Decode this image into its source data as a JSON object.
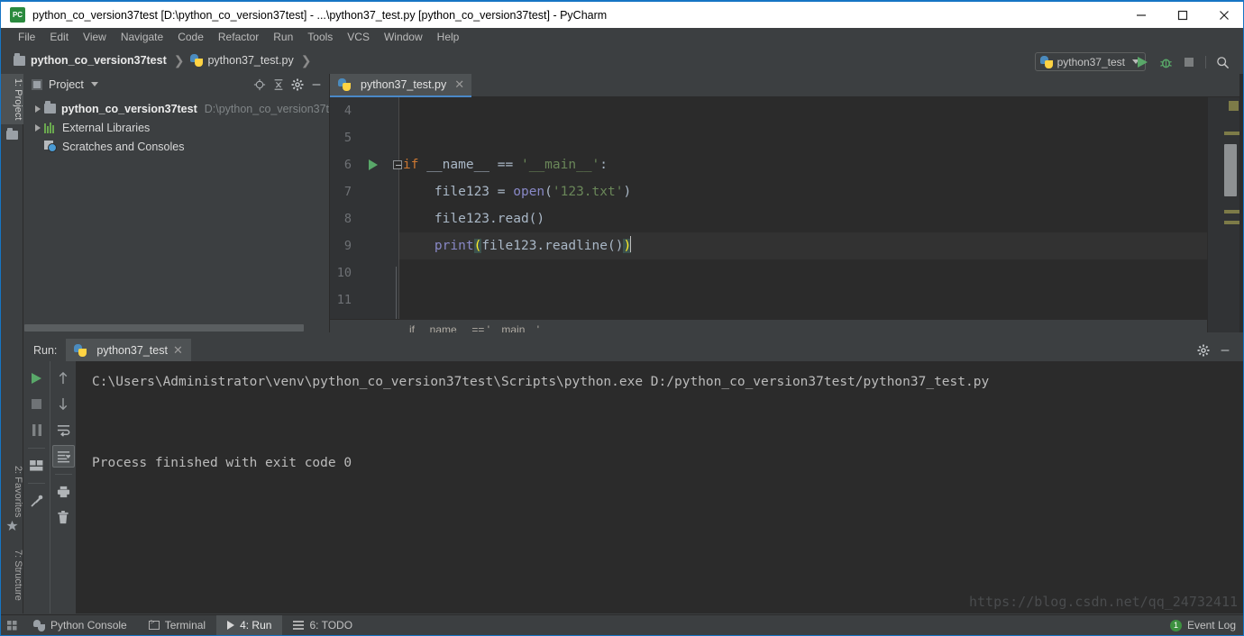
{
  "window": {
    "title": "python_co_version37test [D:\\python_co_version37test] - ...\\python37_test.py [python_co_version37test] - PyCharm",
    "app_icon": "pycharm-icon",
    "minimize_label": "—",
    "maximize_label": "□",
    "close_label": "✕"
  },
  "menu": {
    "items": [
      {
        "label": "File"
      },
      {
        "label": "Edit"
      },
      {
        "label": "View"
      },
      {
        "label": "Navigate"
      },
      {
        "label": "Code"
      },
      {
        "label": "Refactor"
      },
      {
        "label": "Run"
      },
      {
        "label": "Tools"
      },
      {
        "label": "VCS"
      },
      {
        "label": "Window"
      },
      {
        "label": "Help"
      }
    ]
  },
  "navbar": {
    "breadcrumb": [
      {
        "label": "python_co_version37test",
        "icon": "folder-icon"
      },
      {
        "label": "python37_test.py",
        "icon": "python-file-icon"
      }
    ],
    "separator": "❯",
    "run_config": {
      "label": "python37_test",
      "icon": "python-icon"
    },
    "actions": [
      {
        "name": "run-button",
        "icon": "play-icon"
      },
      {
        "name": "debug-button",
        "icon": "bug-icon"
      },
      {
        "name": "stop-button",
        "icon": "stop-icon"
      },
      {
        "name": "search-everywhere-button",
        "icon": "search-icon"
      }
    ]
  },
  "left_tool_tabs": [
    {
      "label": "1: Project",
      "icon": "folder-icon",
      "active": true
    },
    {
      "label": "2: Favorites",
      "icon": "star-icon",
      "active": false
    },
    {
      "label": "7: Structure",
      "icon": "structure-icon",
      "active": false
    }
  ],
  "project_panel": {
    "title": "Project",
    "icons": [
      {
        "name": "target-icon"
      },
      {
        "name": "collapse-all-icon"
      },
      {
        "name": "gear-icon"
      },
      {
        "name": "hide-icon"
      }
    ],
    "tree": [
      {
        "label": "python_co_version37test",
        "path": "D:\\python_co_version37t",
        "icon": "folder-icon",
        "expandable": true,
        "bold": true
      },
      {
        "label": "External Libraries",
        "path": "",
        "icon": "libraries-icon",
        "expandable": true,
        "bold": false
      },
      {
        "label": "Scratches and Consoles",
        "path": "",
        "icon": "scratches-icon",
        "expandable": false,
        "bold": false
      }
    ]
  },
  "editor": {
    "tab": {
      "label": "python37_test.py",
      "icon": "python-file-icon",
      "close": "✕"
    },
    "breadcrumb": "if __name__ == '__main__'",
    "lines": [
      {
        "no": "4",
        "gutter_run": false,
        "fold": false,
        "current": false,
        "tokens": []
      },
      {
        "no": "5",
        "gutter_run": false,
        "fold": false,
        "current": false,
        "tokens": []
      },
      {
        "no": "6",
        "gutter_run": true,
        "fold": true,
        "current": false,
        "tokens": [
          {
            "t": "if ",
            "c": "kw"
          },
          {
            "t": "__name__ ",
            "c": "id"
          },
          {
            "t": "== ",
            "c": "op"
          },
          {
            "t": "'__main__'",
            "c": "str"
          },
          {
            "t": ":",
            "c": "op"
          }
        ]
      },
      {
        "no": "7",
        "gutter_run": false,
        "fold": false,
        "current": false,
        "tokens": [
          {
            "t": "    file123 ",
            "c": "id"
          },
          {
            "t": "= ",
            "c": "op"
          },
          {
            "t": "open",
            "c": "builtin"
          },
          {
            "t": "(",
            "c": "op"
          },
          {
            "t": "'123.txt'",
            "c": "str"
          },
          {
            "t": ")",
            "c": "op"
          }
        ]
      },
      {
        "no": "8",
        "gutter_run": false,
        "fold": false,
        "current": false,
        "tokens": [
          {
            "t": "    file123.read()",
            "c": "id"
          }
        ]
      },
      {
        "no": "9",
        "gutter_run": false,
        "fold": false,
        "current": true,
        "tokens": [
          {
            "t": "    ",
            "c": "id"
          },
          {
            "t": "print",
            "c": "builtin"
          },
          {
            "t": "(",
            "c": "paren-hl"
          },
          {
            "t": "file123.readline()",
            "c": "id"
          },
          {
            "t": ")",
            "c": "paren-hl"
          }
        ]
      },
      {
        "no": "10",
        "gutter_run": false,
        "fold": false,
        "current": false,
        "tokens": []
      },
      {
        "no": "11",
        "gutter_run": false,
        "fold": false,
        "current": false,
        "tokens": []
      }
    ]
  },
  "run_panel": {
    "label": "Run:",
    "tab": {
      "label": "python37_test",
      "icon": "python-icon",
      "close": "✕"
    },
    "header_actions": [
      {
        "name": "settings-gear-icon"
      },
      {
        "name": "hide-panel-icon"
      }
    ],
    "toolbar_left": [
      {
        "name": "rerun-button",
        "icon": "play-icon"
      },
      {
        "name": "stop-button",
        "icon": "stop-icon"
      },
      {
        "name": "pause-button",
        "icon": "pause-icon"
      },
      {
        "name": "layout-button",
        "icon": "layout-icon"
      },
      {
        "name": "pin-tab-button",
        "icon": "pin-icon"
      }
    ],
    "toolbar_right": [
      {
        "name": "up-button",
        "icon": "arrow-up-icon"
      },
      {
        "name": "down-button",
        "icon": "arrow-down-icon"
      },
      {
        "name": "soft-wrap-button",
        "icon": "soft-wrap-icon"
      },
      {
        "name": "scroll-to-end-button",
        "icon": "scroll-end-icon",
        "selected": true
      },
      {
        "name": "print-button",
        "icon": "printer-icon"
      },
      {
        "name": "clear-all-button",
        "icon": "trash-icon"
      }
    ],
    "console": {
      "command": "C:\\Users\\Administrator\\venv\\python_co_version37test\\Scripts\\python.exe D:/python_co_version37test/python37_test.py",
      "result": "Process finished with exit code 0"
    },
    "watermark": "https://blog.csdn.net/qq_24732411"
  },
  "status_bar": {
    "items": [
      {
        "label": "Python Console",
        "icon": "python-icon",
        "active": false
      },
      {
        "label": "Terminal",
        "icon": "terminal-icon",
        "active": false
      },
      {
        "label": "4: Run",
        "icon": "play-icon",
        "active": true
      },
      {
        "label": "6: TODO",
        "icon": "todo-icon",
        "active": false
      }
    ],
    "event_log": {
      "label": "Event Log",
      "badge": "1"
    }
  },
  "colors": {
    "accent": "#4a88c7",
    "title_border": "#1675c4",
    "panel_bg": "#3c3f41",
    "editor_bg": "#2b2b2b",
    "keyword": "#cc7832",
    "string": "#6a8759",
    "builtin": "#8888c6",
    "identifier": "#a9b7c6",
    "paren_match": "#ffef28",
    "run_green": "#59a869",
    "badge_green": "#3d9140"
  }
}
